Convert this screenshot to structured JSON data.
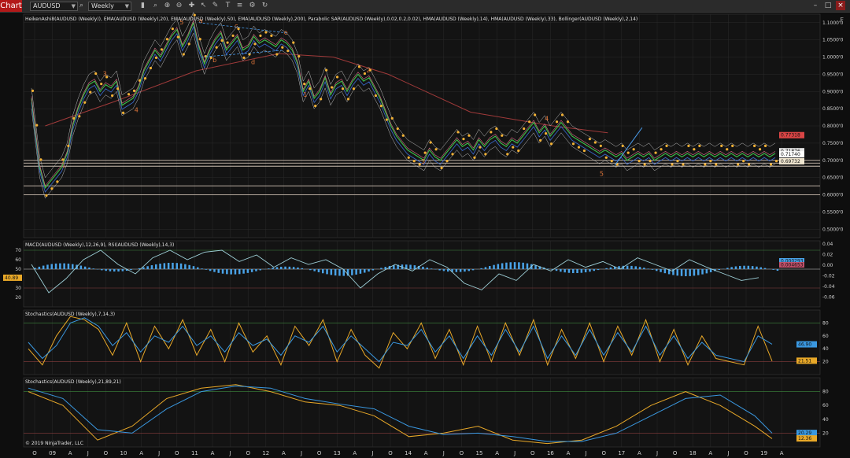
{
  "toolbar": {
    "chart_tab": "Chart",
    "symbol": "AUDUSD",
    "period": "Weekly",
    "icons": [
      "bar-chart-icon",
      "search-icon",
      "zoom-out-icon",
      "zoom-in-icon",
      "crosshair-icon",
      "cursor-icon",
      "pencil-icon",
      "text-icon",
      "list-icon",
      "gear-icon",
      "refresh-icon"
    ],
    "window_buttons": [
      "minimize-icon",
      "maximize-icon",
      "close-icon"
    ]
  },
  "corner_label": "F",
  "copyright": "© 2019 NinjaTrader, LLC",
  "colors": {
    "background": "#0e0e0e",
    "grid": "#2a2a2a",
    "psar": "#f2b135",
    "ema20": "#3cbe4a",
    "ema50": "#3a6ad0",
    "ema200": "#a03a3a",
    "macd_hist": "#4aa3e8",
    "stoch_fast": "#e8a828",
    "stoch_slow": "#3a98e0",
    "wave_label": "#e0763a"
  },
  "chart_data": [
    {
      "type": "line",
      "title": "HeikenAshi8(AUDUSD (Weekly)), EMA(AUDUSD (Weekly),20), EMA(AUDUSD (Weekly),50), EMA(AUDUSD (Weekly),200), Parabolic SAR(AUDUSD (Weekly),0.02,0.2,0.02), HMA(AUDUSD (Weekly),14), HMA(AUDUSD (Weekly),33), Bollinger(AUDUSD (Weekly),2,14)",
      "y_ticks": [
        "1.1000'0",
        "1.0500'0",
        "1.0000'0",
        "0.9500'0",
        "0.9000'0",
        "0.8500'0",
        "0.8000'0",
        "0.7500'0",
        "0.7000'0",
        "0.6500'0",
        "0.6000'0",
        "0.5500'0",
        "0.5000'0"
      ],
      "ylim": [
        0.48,
        1.12
      ],
      "price_badges": [
        {
          "text": "0.77318",
          "value": 0.77318,
          "color": "#d94545"
        },
        {
          "text": "0.71876",
          "value": 0.7265,
          "color": "#e8e8e8"
        },
        {
          "text": "0.71740",
          "value": 0.7174,
          "color": "#ffffff"
        },
        {
          "text": "0.69732",
          "value": 0.6973,
          "color": "#f0e6d0"
        }
      ],
      "horizontal_levels": [
        0.7,
        0.692,
        0.683,
        0.626,
        0.6
      ],
      "price": {
        "x": [
          0,
          3,
          6,
          10,
          14,
          18,
          22,
          26,
          30,
          34,
          38,
          42,
          46,
          50,
          54,
          58,
          62,
          66,
          70,
          74,
          78,
          82,
          86,
          90,
          94,
          98,
          102,
          106,
          110,
          114,
          118,
          122,
          126,
          130,
          134,
          138,
          142,
          146,
          150,
          154,
          158,
          162,
          166,
          170,
          174,
          178,
          182,
          186,
          190,
          194,
          198,
          202,
          206,
          210,
          214,
          218,
          222,
          226,
          230,
          234,
          238,
          242,
          246,
          250,
          254,
          258,
          262,
          266,
          270,
          274,
          278,
          282,
          286,
          290,
          294,
          298,
          302,
          306,
          310,
          314,
          318,
          322,
          326,
          330,
          334,
          338,
          342,
          346,
          350,
          354,
          358,
          362,
          366,
          370,
          374,
          378,
          382,
          386,
          390,
          394,
          398,
          402,
          406,
          410,
          414,
          418,
          422,
          426,
          430,
          434,
          438,
          442,
          446,
          450,
          454,
          458,
          462,
          466,
          470,
          474,
          478,
          482,
          486,
          490,
          494,
          498,
          502,
          506,
          510,
          514,
          518,
          522,
          526,
          530,
          534,
          538,
          542
        ],
        "y": [
          0.88,
          0.78,
          0.68,
          0.62,
          0.64,
          0.66,
          0.68,
          0.72,
          0.8,
          0.85,
          0.89,
          0.92,
          0.93,
          0.9,
          0.92,
          0.91,
          0.93,
          0.86,
          0.87,
          0.88,
          0.91,
          0.96,
          0.99,
          1.02,
          1.0,
          1.03,
          1.06,
          1.08,
          1.03,
          1.06,
          1.1,
          1.03,
          0.98,
          1.02,
          1.05,
          1.07,
          1.02,
          1.04,
          1.06,
          1.02,
          1.03,
          1.06,
          1.04,
          1.05,
          1.04,
          1.03,
          1.05,
          1.04,
          1.02,
          0.98,
          0.9,
          0.93,
          0.88,
          0.9,
          0.94,
          0.89,
          0.92,
          0.93,
          0.9,
          0.93,
          0.95,
          0.93,
          0.94,
          0.91,
          0.88,
          0.84,
          0.8,
          0.77,
          0.75,
          0.73,
          0.72,
          0.71,
          0.7,
          0.73,
          0.71,
          0.7,
          0.72,
          0.74,
          0.76,
          0.74,
          0.75,
          0.73,
          0.76,
          0.74,
          0.76,
          0.77,
          0.75,
          0.74,
          0.76,
          0.75,
          0.77,
          0.79,
          0.81,
          0.78,
          0.8,
          0.77,
          0.79,
          0.81,
          0.79,
          0.77,
          0.76,
          0.75,
          0.74,
          0.73,
          0.72,
          0.73,
          0.72,
          0.71,
          0.72,
          0.7,
          0.71,
          0.72,
          0.71,
          0.72,
          0.7,
          0.71,
          0.72,
          0.71,
          0.72,
          0.71,
          0.72,
          0.71,
          0.72,
          0.71,
          0.72,
          0.71,
          0.72,
          0.71,
          0.72,
          0.71,
          0.72,
          0.71,
          0.72,
          0.71,
          0.72,
          0.71,
          0.72
        ]
      },
      "wave_labels": [
        {
          "text": "1",
          "x": 22,
          "y": 0.68
        },
        {
          "text": "3",
          "x": 52,
          "y": 0.945
        },
        {
          "text": "4",
          "x": 75,
          "y": 0.84
        },
        {
          "text": "5",
          "x": 108,
          "y": 1.095
        },
        {
          "text": "a",
          "x": 122,
          "y": 1.1
        },
        {
          "text": "b",
          "x": 132,
          "y": 0.985
        },
        {
          "text": "c",
          "x": 148,
          "y": 1.085
        },
        {
          "text": "d",
          "x": 160,
          "y": 0.98
        },
        {
          "text": "e",
          "x": 184,
          "y": 1.065
        },
        {
          "text": "1",
          "x": 198,
          "y": 0.885
        },
        {
          "text": "2",
          "x": 244,
          "y": 0.955
        },
        {
          "text": "3",
          "x": 284,
          "y": 0.69
        },
        {
          "text": "4",
          "x": 374,
          "y": 0.815
        },
        {
          "text": "5",
          "x": 414,
          "y": 0.655
        }
      ],
      "series": [
        {
          "name": "EMA 200",
          "x": [
            10,
            60,
            120,
            180,
            220,
            260,
            320,
            380,
            420
          ],
          "y": [
            0.8,
            0.87,
            0.96,
            1.01,
            1.0,
            0.95,
            0.84,
            0.8,
            0.78
          ]
        }
      ]
    },
    {
      "type": "line",
      "title": "MACD(AUDUSD (Weekly),12,26,9), RSI(AUDUSD (Weekly),14,3)",
      "left_ticks": [
        "70",
        "60",
        "50",
        "40.89",
        "30",
        "20"
      ],
      "right_ticks": [
        "0.04",
        "0.02",
        "0.00",
        "-0.02",
        "-0.04",
        "-0.06"
      ],
      "right_badges": [
        {
          "text": "0.000293",
          "value": 0.0003,
          "color": "#4aa3e8"
        },
        {
          "text": "0.004653",
          "value": -0.004,
          "color": "#c0506a"
        }
      ],
      "left_badge": {
        "text": "40.89",
        "value": 40.89,
        "color": "#e8a828"
      },
      "rsi": {
        "x": [
          0,
          10,
          20,
          30,
          40,
          50,
          60,
          70,
          80,
          90,
          100,
          110,
          120,
          130,
          140,
          150,
          160,
          170,
          180,
          190,
          200,
          210,
          220,
          230,
          240,
          250,
          260,
          270,
          280,
          290,
          300,
          310,
          320,
          330,
          340,
          350,
          360,
          370,
          380,
          390,
          400,
          410,
          420
        ],
        "y": [
          55,
          25,
          40,
          60,
          70,
          55,
          45,
          62,
          70,
          60,
          68,
          70,
          58,
          65,
          52,
          62,
          55,
          60,
          50,
          30,
          45,
          55,
          48,
          60,
          52,
          35,
          28,
          45,
          38,
          55,
          48,
          60,
          52,
          58,
          50,
          62,
          55,
          48,
          60,
          52,
          45,
          38,
          41
        ]
      }
    },
    {
      "type": "line",
      "title": "Stochastics(AUDUSD (Weekly),7,14,3)",
      "y_ticks": [
        "80",
        "60",
        "40",
        "20"
      ],
      "right_badges": [
        {
          "text": "46.90",
          "value": 46.9,
          "color": "#3a98e0"
        },
        {
          "text": "21.51",
          "value": 21.51,
          "color": "#e8a828"
        }
      ],
      "series": [
        {
          "color": "#e8a828",
          "x": [
            0,
            8,
            16,
            24,
            32,
            40,
            48,
            56,
            64,
            72,
            80,
            88,
            96,
            104,
            112,
            120,
            128,
            136,
            144,
            152,
            160,
            168,
            176,
            184,
            192,
            200,
            208,
            216,
            224,
            232,
            240,
            248,
            256,
            264,
            272,
            280,
            288,
            296,
            304,
            312,
            320,
            328,
            336,
            344,
            352,
            360,
            368,
            376,
            384,
            392,
            400,
            408,
            416,
            424
          ],
          "y": [
            40,
            15,
            60,
            90,
            85,
            70,
            30,
            80,
            20,
            75,
            40,
            85,
            30,
            70,
            20,
            80,
            35,
            60,
            15,
            75,
            45,
            85,
            20,
            70,
            30,
            10,
            65,
            40,
            80,
            25,
            70,
            15,
            75,
            20,
            80,
            30,
            85,
            15,
            70,
            25,
            80,
            20,
            75,
            30,
            85,
            20,
            70,
            15,
            60,
            25,
            20,
            15,
            75,
            21
          ]
        },
        {
          "color": "#3a98e0",
          "x": [
            0,
            8,
            16,
            24,
            32,
            40,
            48,
            56,
            64,
            72,
            80,
            88,
            96,
            104,
            112,
            120,
            128,
            136,
            144,
            152,
            160,
            168,
            176,
            184,
            192,
            200,
            208,
            216,
            224,
            232,
            240,
            248,
            256,
            264,
            272,
            280,
            288,
            296,
            304,
            312,
            320,
            328,
            336,
            344,
            352,
            360,
            368,
            376,
            384,
            392,
            400,
            408,
            416,
            424
          ],
          "y": [
            50,
            25,
            45,
            80,
            88,
            75,
            45,
            65,
            35,
            60,
            50,
            75,
            45,
            60,
            35,
            65,
            45,
            55,
            30,
            60,
            50,
            75,
            35,
            60,
            40,
            20,
            50,
            45,
            70,
            35,
            60,
            25,
            60,
            30,
            70,
            35,
            75,
            25,
            60,
            30,
            70,
            30,
            65,
            35,
            75,
            30,
            60,
            25,
            50,
            30,
            25,
            20,
            60,
            47
          ]
        }
      ]
    },
    {
      "type": "line",
      "title": "Stochastics(AUDUSD (Weekly),21,89,21)",
      "y_ticks": [
        "80",
        "60",
        "40",
        "20"
      ],
      "right_badges": [
        {
          "text": "20.29",
          "value": 20.29,
          "color": "#3a98e0"
        },
        {
          "text": "12.36",
          "value": 12.36,
          "color": "#e8a828"
        }
      ],
      "series": [
        {
          "color": "#e8a828",
          "x": [
            0,
            20,
            40,
            60,
            80,
            100,
            120,
            140,
            160,
            180,
            200,
            220,
            240,
            260,
            280,
            300,
            320,
            340,
            360,
            380,
            400,
            420,
            430
          ],
          "y": [
            80,
            60,
            10,
            30,
            70,
            85,
            90,
            80,
            65,
            60,
            45,
            15,
            20,
            30,
            10,
            5,
            10,
            30,
            60,
            80,
            60,
            30,
            12
          ]
        },
        {
          "color": "#3a98e0",
          "x": [
            0,
            20,
            40,
            60,
            80,
            100,
            120,
            140,
            160,
            180,
            200,
            220,
            240,
            260,
            280,
            300,
            320,
            340,
            360,
            380,
            400,
            420,
            430
          ],
          "y": [
            85,
            70,
            25,
            20,
            55,
            80,
            88,
            85,
            70,
            62,
            55,
            30,
            18,
            20,
            15,
            8,
            8,
            20,
            45,
            70,
            75,
            45,
            20
          ]
        }
      ],
      "x_ticks": [
        "O",
        "09",
        "A",
        "J",
        "O",
        "10",
        "A",
        "J",
        "O",
        "11",
        "A",
        "J",
        "O",
        "12",
        "A",
        "J",
        "O",
        "13",
        "A",
        "J",
        "O",
        "14",
        "A",
        "J",
        "O",
        "15",
        "A",
        "J",
        "O",
        "16",
        "A",
        "J",
        "O",
        "17",
        "A",
        "J",
        "O",
        "18",
        "A",
        "J",
        "O",
        "19",
        "A"
      ]
    }
  ]
}
